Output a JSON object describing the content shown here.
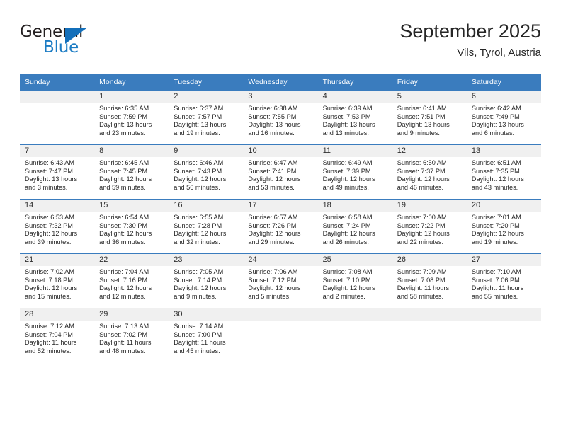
{
  "brand": {
    "name_top": "General",
    "name_bottom": "Blue",
    "triangle_color": "#136fba",
    "blue_color": "#1c7cc4"
  },
  "header": {
    "title": "September 2025",
    "subtitle": "Vils, Tyrol, Austria"
  },
  "theme": {
    "header_bar": "#3a7cbe",
    "day_band": "#f0f0f0",
    "text": "#262626"
  },
  "weekdays": [
    "Sunday",
    "Monday",
    "Tuesday",
    "Wednesday",
    "Thursday",
    "Friday",
    "Saturday"
  ],
  "weeks": [
    [
      {
        "day": "",
        "sunrise": "",
        "sunset": "",
        "daylight1": "",
        "daylight2": ""
      },
      {
        "day": "1",
        "sunrise": "Sunrise: 6:35 AM",
        "sunset": "Sunset: 7:59 PM",
        "daylight1": "Daylight: 13 hours",
        "daylight2": "and 23 minutes."
      },
      {
        "day": "2",
        "sunrise": "Sunrise: 6:37 AM",
        "sunset": "Sunset: 7:57 PM",
        "daylight1": "Daylight: 13 hours",
        "daylight2": "and 19 minutes."
      },
      {
        "day": "3",
        "sunrise": "Sunrise: 6:38 AM",
        "sunset": "Sunset: 7:55 PM",
        "daylight1": "Daylight: 13 hours",
        "daylight2": "and 16 minutes."
      },
      {
        "day": "4",
        "sunrise": "Sunrise: 6:39 AM",
        "sunset": "Sunset: 7:53 PM",
        "daylight1": "Daylight: 13 hours",
        "daylight2": "and 13 minutes."
      },
      {
        "day": "5",
        "sunrise": "Sunrise: 6:41 AM",
        "sunset": "Sunset: 7:51 PM",
        "daylight1": "Daylight: 13 hours",
        "daylight2": "and 9 minutes."
      },
      {
        "day": "6",
        "sunrise": "Sunrise: 6:42 AM",
        "sunset": "Sunset: 7:49 PM",
        "daylight1": "Daylight: 13 hours",
        "daylight2": "and 6 minutes."
      }
    ],
    [
      {
        "day": "7",
        "sunrise": "Sunrise: 6:43 AM",
        "sunset": "Sunset: 7:47 PM",
        "daylight1": "Daylight: 13 hours",
        "daylight2": "and 3 minutes."
      },
      {
        "day": "8",
        "sunrise": "Sunrise: 6:45 AM",
        "sunset": "Sunset: 7:45 PM",
        "daylight1": "Daylight: 12 hours",
        "daylight2": "and 59 minutes."
      },
      {
        "day": "9",
        "sunrise": "Sunrise: 6:46 AM",
        "sunset": "Sunset: 7:43 PM",
        "daylight1": "Daylight: 12 hours",
        "daylight2": "and 56 minutes."
      },
      {
        "day": "10",
        "sunrise": "Sunrise: 6:47 AM",
        "sunset": "Sunset: 7:41 PM",
        "daylight1": "Daylight: 12 hours",
        "daylight2": "and 53 minutes."
      },
      {
        "day": "11",
        "sunrise": "Sunrise: 6:49 AM",
        "sunset": "Sunset: 7:39 PM",
        "daylight1": "Daylight: 12 hours",
        "daylight2": "and 49 minutes."
      },
      {
        "day": "12",
        "sunrise": "Sunrise: 6:50 AM",
        "sunset": "Sunset: 7:37 PM",
        "daylight1": "Daylight: 12 hours",
        "daylight2": "and 46 minutes."
      },
      {
        "day": "13",
        "sunrise": "Sunrise: 6:51 AM",
        "sunset": "Sunset: 7:35 PM",
        "daylight1": "Daylight: 12 hours",
        "daylight2": "and 43 minutes."
      }
    ],
    [
      {
        "day": "14",
        "sunrise": "Sunrise: 6:53 AM",
        "sunset": "Sunset: 7:32 PM",
        "daylight1": "Daylight: 12 hours",
        "daylight2": "and 39 minutes."
      },
      {
        "day": "15",
        "sunrise": "Sunrise: 6:54 AM",
        "sunset": "Sunset: 7:30 PM",
        "daylight1": "Daylight: 12 hours",
        "daylight2": "and 36 minutes."
      },
      {
        "day": "16",
        "sunrise": "Sunrise: 6:55 AM",
        "sunset": "Sunset: 7:28 PM",
        "daylight1": "Daylight: 12 hours",
        "daylight2": "and 32 minutes."
      },
      {
        "day": "17",
        "sunrise": "Sunrise: 6:57 AM",
        "sunset": "Sunset: 7:26 PM",
        "daylight1": "Daylight: 12 hours",
        "daylight2": "and 29 minutes."
      },
      {
        "day": "18",
        "sunrise": "Sunrise: 6:58 AM",
        "sunset": "Sunset: 7:24 PM",
        "daylight1": "Daylight: 12 hours",
        "daylight2": "and 26 minutes."
      },
      {
        "day": "19",
        "sunrise": "Sunrise: 7:00 AM",
        "sunset": "Sunset: 7:22 PM",
        "daylight1": "Daylight: 12 hours",
        "daylight2": "and 22 minutes."
      },
      {
        "day": "20",
        "sunrise": "Sunrise: 7:01 AM",
        "sunset": "Sunset: 7:20 PM",
        "daylight1": "Daylight: 12 hours",
        "daylight2": "and 19 minutes."
      }
    ],
    [
      {
        "day": "21",
        "sunrise": "Sunrise: 7:02 AM",
        "sunset": "Sunset: 7:18 PM",
        "daylight1": "Daylight: 12 hours",
        "daylight2": "and 15 minutes."
      },
      {
        "day": "22",
        "sunrise": "Sunrise: 7:04 AM",
        "sunset": "Sunset: 7:16 PM",
        "daylight1": "Daylight: 12 hours",
        "daylight2": "and 12 minutes."
      },
      {
        "day": "23",
        "sunrise": "Sunrise: 7:05 AM",
        "sunset": "Sunset: 7:14 PM",
        "daylight1": "Daylight: 12 hours",
        "daylight2": "and 9 minutes."
      },
      {
        "day": "24",
        "sunrise": "Sunrise: 7:06 AM",
        "sunset": "Sunset: 7:12 PM",
        "daylight1": "Daylight: 12 hours",
        "daylight2": "and 5 minutes."
      },
      {
        "day": "25",
        "sunrise": "Sunrise: 7:08 AM",
        "sunset": "Sunset: 7:10 PM",
        "daylight1": "Daylight: 12 hours",
        "daylight2": "and 2 minutes."
      },
      {
        "day": "26",
        "sunrise": "Sunrise: 7:09 AM",
        "sunset": "Sunset: 7:08 PM",
        "daylight1": "Daylight: 11 hours",
        "daylight2": "and 58 minutes."
      },
      {
        "day": "27",
        "sunrise": "Sunrise: 7:10 AM",
        "sunset": "Sunset: 7:06 PM",
        "daylight1": "Daylight: 11 hours",
        "daylight2": "and 55 minutes."
      }
    ],
    [
      {
        "day": "28",
        "sunrise": "Sunrise: 7:12 AM",
        "sunset": "Sunset: 7:04 PM",
        "daylight1": "Daylight: 11 hours",
        "daylight2": "and 52 minutes."
      },
      {
        "day": "29",
        "sunrise": "Sunrise: 7:13 AM",
        "sunset": "Sunset: 7:02 PM",
        "daylight1": "Daylight: 11 hours",
        "daylight2": "and 48 minutes."
      },
      {
        "day": "30",
        "sunrise": "Sunrise: 7:14 AM",
        "sunset": "Sunset: 7:00 PM",
        "daylight1": "Daylight: 11 hours",
        "daylight2": "and 45 minutes."
      },
      {
        "day": "",
        "sunrise": "",
        "sunset": "",
        "daylight1": "",
        "daylight2": ""
      },
      {
        "day": "",
        "sunrise": "",
        "sunset": "",
        "daylight1": "",
        "daylight2": ""
      },
      {
        "day": "",
        "sunrise": "",
        "sunset": "",
        "daylight1": "",
        "daylight2": ""
      },
      {
        "day": "",
        "sunrise": "",
        "sunset": "",
        "daylight1": "",
        "daylight2": ""
      }
    ]
  ]
}
